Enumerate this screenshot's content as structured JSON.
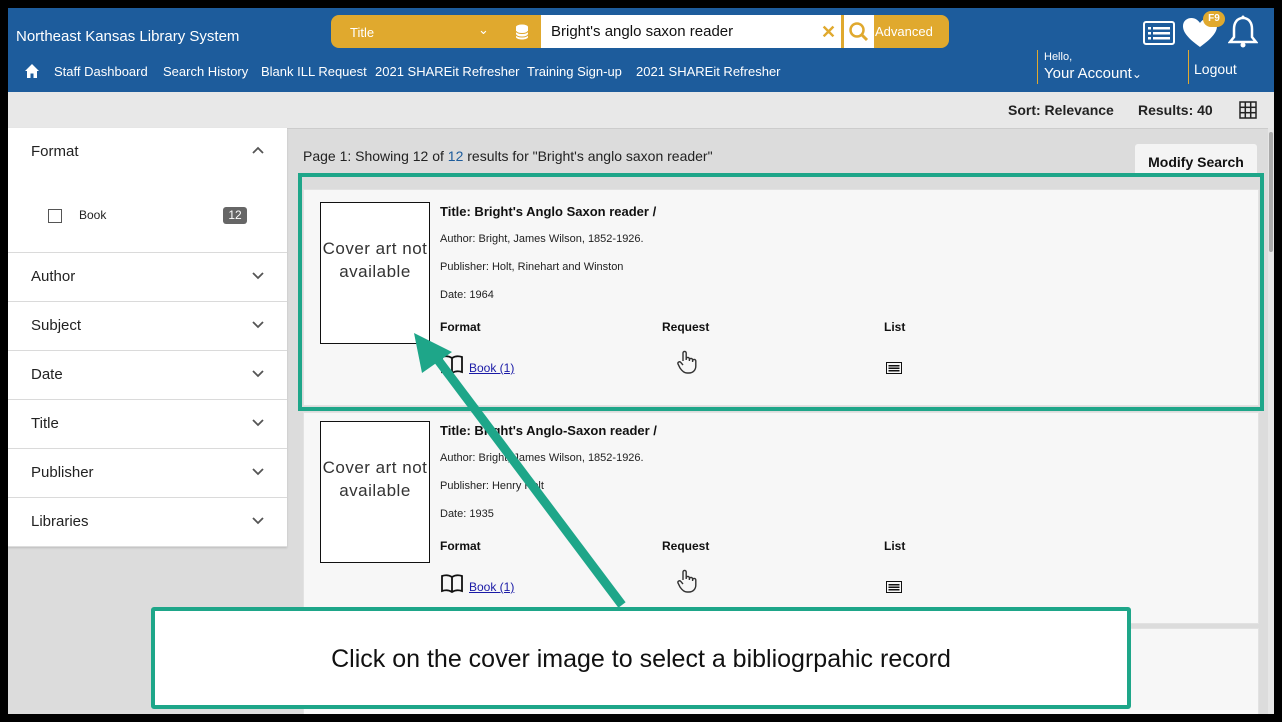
{
  "header": {
    "app_title": "Northeast Kansas Library System",
    "search": {
      "type_label": "Title",
      "query": "Bright's anglo saxon reader",
      "advanced_label": "Advanced"
    },
    "nav": [
      "Staff Dashboard",
      "Search History",
      "Blank ILL Request",
      "2021 SHAREit Refresher",
      "Training Sign-up",
      "2021 SHAREit Refresher"
    ],
    "badge": "F9",
    "hello": "Hello,",
    "account": "Your Account",
    "logout": "Logout"
  },
  "toolbar": {
    "sort": "Sort: Relevance",
    "results": "Results: 40"
  },
  "facets": {
    "format": {
      "label": "Format",
      "option": "Book",
      "count": "12"
    },
    "items": [
      "Author",
      "Subject",
      "Date",
      "Title",
      "Publisher",
      "Libraries"
    ]
  },
  "main": {
    "page_info_prefix": "Page 1: Showing",
    "shown": "12",
    "of": "of",
    "total": "12",
    "page_info_suffix": "results for \"Bright's anglo saxon reader\"",
    "modify_label": "Modify Search",
    "cover_text": "Cover art not available",
    "col_format": "Format",
    "col_request": "Request",
    "col_list": "List",
    "records": [
      {
        "title": "Title: Bright's Anglo Saxon reader /",
        "author": "Author: Bright, James Wilson, 1852-1926.",
        "publisher": "Publisher: Holt, Rinehart and Winston",
        "date": "Date: 1964",
        "format_link": "Book (1)"
      },
      {
        "title": "Title: Bright's Anglo-Saxon reader /",
        "author": "Author: Bright, James Wilson, 1852-1926.",
        "publisher": "Publisher: Henry Holt",
        "date": "Date: 1935",
        "format_link": "Book (1)"
      }
    ]
  },
  "callout": {
    "text": "Click on the cover image to select a bibliogrpahic record"
  },
  "colors": {
    "header_blue": "#1d5c9c",
    "accent_gold": "#e0a92e",
    "callout_teal": "#1ea689"
  }
}
